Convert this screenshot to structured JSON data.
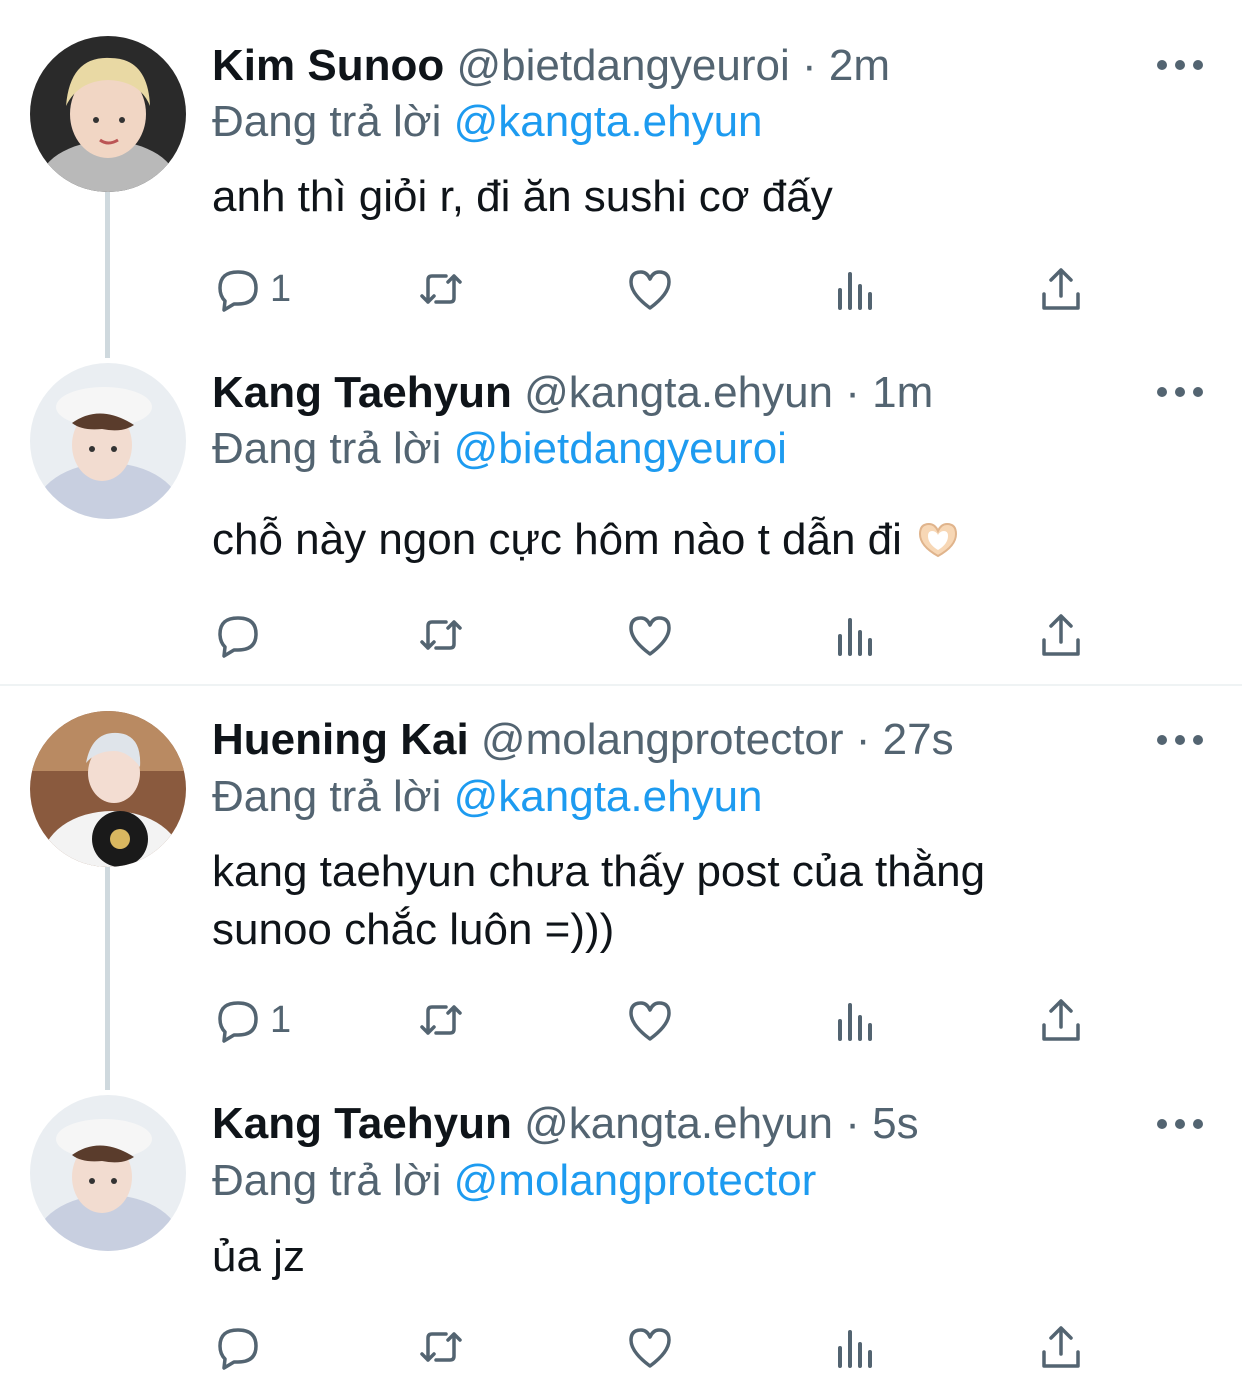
{
  "colors": {
    "link": "#1d9bf0",
    "muted": "#536471",
    "text": "#0f1419",
    "line": "#cfd9de"
  },
  "tweets": [
    {
      "name": "Kim Sunoo",
      "handle": "@bietdangyeuroi",
      "sep": "·",
      "time": "2m",
      "reply_prefix": "Đang trả lời",
      "reply_to": "@kangta.ehyun",
      "text": "anh thì giỏi r, đi ăn sushi cơ đấy",
      "reply_count": "1",
      "avatar_icon": "avatar-photo"
    },
    {
      "name": "Kang Taehyun",
      "handle": "@kangta.ehyun",
      "sep": "·",
      "time": "1m",
      "reply_prefix": "Đang trả lời",
      "reply_to": "@bietdangyeuroi",
      "text": "chỗ này ngon cực hôm nào t dẫn đi",
      "emoji": "heart-hands-emoji",
      "reply_count": "",
      "avatar_icon": "avatar-photo"
    },
    {
      "name": "Huening Kai",
      "handle": "@molangprotector",
      "sep": "·",
      "time": "27s",
      "reply_prefix": "Đang trả lời",
      "reply_to": "@kangta.ehyun",
      "text_line1": "kang taehyun chưa thấy post của thằng",
      "text_line2": "sunoo chắc luôn =)))",
      "reply_count": "1",
      "avatar_icon": "avatar-photo"
    },
    {
      "name": "Kang Taehyun",
      "handle": "@kangta.ehyun",
      "sep": "·",
      "time": "5s",
      "reply_prefix": "Đang trả lời",
      "reply_to": "@molangprotector",
      "text": "ủa jz",
      "reply_count": "",
      "avatar_icon": "avatar-photo"
    }
  ],
  "action_icons": [
    "reply-icon",
    "retweet-icon",
    "like-icon",
    "views-icon",
    "share-icon"
  ]
}
